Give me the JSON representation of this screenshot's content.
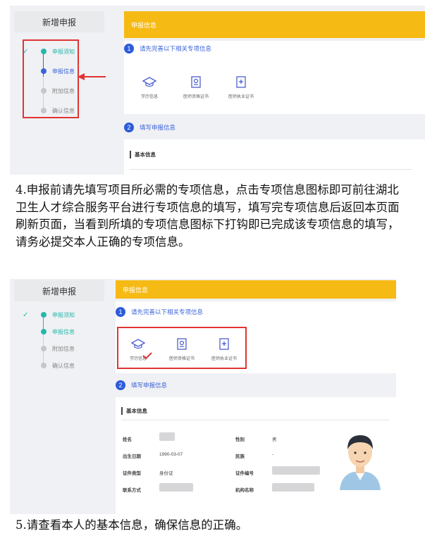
{
  "shot1": {
    "left_header": "新增申报",
    "steps": [
      {
        "label": "申报须知",
        "state": "done",
        "check": "✓"
      },
      {
        "label": "申报信息",
        "state": "active"
      },
      {
        "label": "附加信息",
        "state": "pending"
      },
      {
        "label": "确认信息",
        "state": "pending"
      }
    ],
    "main_header": "申报信息",
    "section1": {
      "num": "1",
      "title": "请先完善以下相关专项信息"
    },
    "cards": [
      {
        "label": "学历信息",
        "icon": "graduation-cap-icon"
      },
      {
        "label": "医师资格证书",
        "icon": "certificate-icon"
      },
      {
        "label": "医师执业证书",
        "icon": "medical-license-icon"
      }
    ],
    "section2": {
      "num": "2",
      "title": "填写申报信息"
    },
    "form_title": "基本信息"
  },
  "paragraph1": "4.申报前请先填写项目所必需的专项信息，点击专项信息图标即可前往湖北卫生人才综合服务平台进行专项信息的填写，填写完专项信息后返回本页面刷新页面，当看到所填的专项信息图标下打钩即已完成该专项信息的填写，请务必提交本人正确的专项信息。",
  "shot2": {
    "left_header": "新增申报",
    "steps": [
      {
        "label": "申报须知",
        "state": "done",
        "check": "✓"
      },
      {
        "label": "申报信息",
        "state": "done"
      },
      {
        "label": "附加信息",
        "state": "pending"
      },
      {
        "label": "确认信息",
        "state": "pending"
      }
    ],
    "main_header": "申报信息",
    "section1": {
      "num": "1",
      "title": "请先完善以下相关专项信息"
    },
    "cards": [
      {
        "label": "学历信息",
        "icon": "graduation-cap-icon",
        "checked": true
      },
      {
        "label": "医师资格证书",
        "icon": "certificate-icon"
      },
      {
        "label": "医师执业证书",
        "icon": "medical-license-icon"
      }
    ],
    "section2": {
      "num": "2",
      "title": "填写申报信息"
    },
    "form_title": "基本信息",
    "fields": {
      "name_label": "姓名",
      "gender_label": "性别",
      "gender_value": "男",
      "birth_label": "出生日期",
      "birth_value": "1990-03-07",
      "ethnicity_label": "民族",
      "ethnicity_value": "-",
      "idtype_label": "证件类型",
      "idtype_value": "身份证",
      "idnum_label": "证件编号",
      "contact_label": "联系方式",
      "org_label": "机构名称"
    }
  },
  "paragraph2": "5.请查看本人的基本信息，确保信息的正确。",
  "colors": {
    "accent_yellow": "#f6ba14",
    "step_done": "#27b7a8",
    "step_active": "#3a63d8",
    "highlight_red": "#e03434"
  }
}
